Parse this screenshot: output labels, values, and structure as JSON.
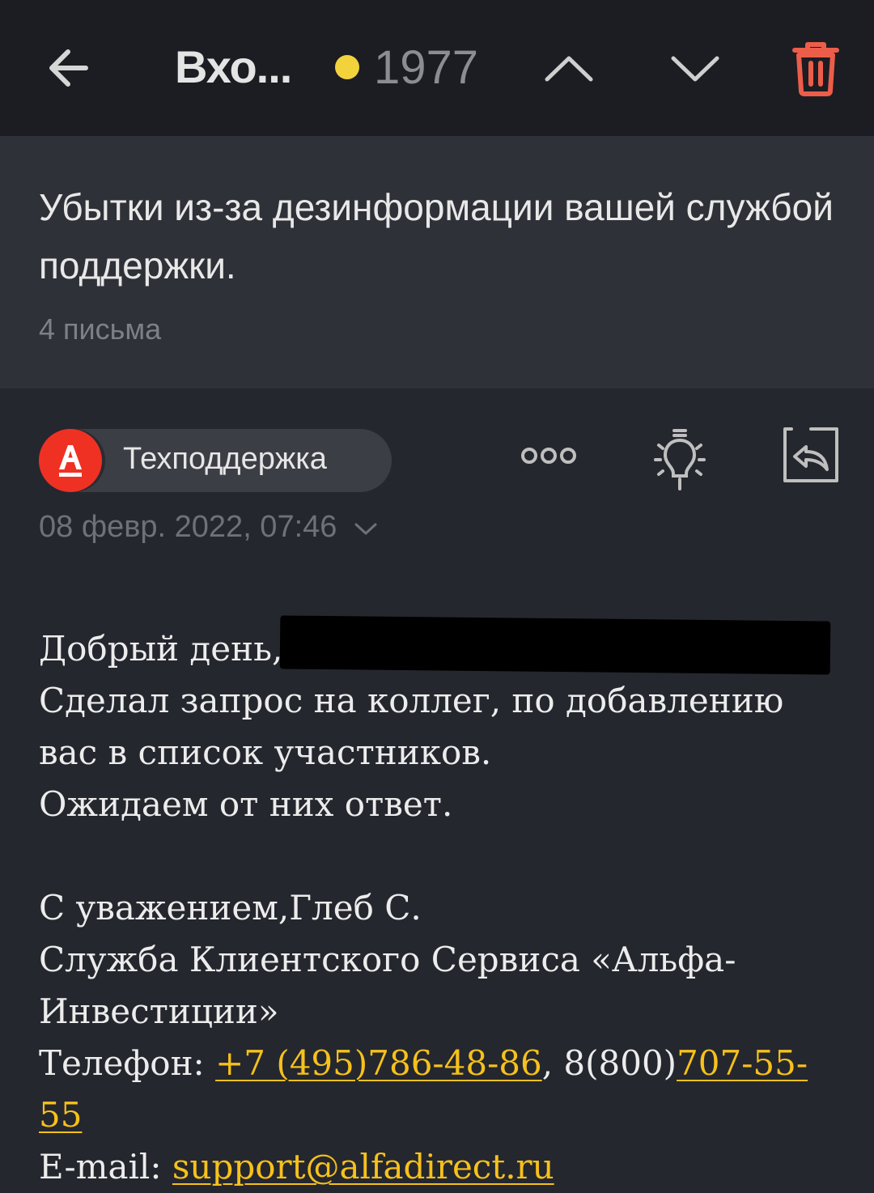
{
  "toolbar": {
    "folder_title": "Вхо...",
    "unread_count": "1977",
    "unread_dot_color": "#f3d33b",
    "trash_color": "#ec5d4a",
    "icons": [
      "back-arrow-icon",
      "chevron-up-icon",
      "chevron-down-icon",
      "trash-icon"
    ]
  },
  "thread": {
    "subject": "Убытки из-за дезинформации вашей службой поддержки.",
    "count_label": "4 письма"
  },
  "message": {
    "sender_name": "Техподдержка",
    "avatar_letter": "А",
    "avatar_color": "#ef3124",
    "date": "08 февр. 2022, 07:46",
    "icons": [
      "more-dots-icon",
      "lightbulb-icon",
      "reply-icon"
    ]
  },
  "body": {
    "greeting": "Добрый день,",
    "line1": "Сделал запрос на коллег, по добавлению",
    "line2": "вас в список участников.",
    "line3": "Ожидаем от них ответ.",
    "sign1": "С уважением,Глеб С.",
    "sign2": "Служба Клиентского Сервиса «Альфа-",
    "sign3": "Инвестиции»",
    "phone_label": "Телефон: ",
    "phone1": "+7 (495)786-48-86",
    "phone_sep": ", 8(800)",
    "phone2": "707-55-55",
    "email_label": "E-mail: ",
    "email": "support@alfadirect.ru",
    "link_color": "#f6c11b"
  }
}
